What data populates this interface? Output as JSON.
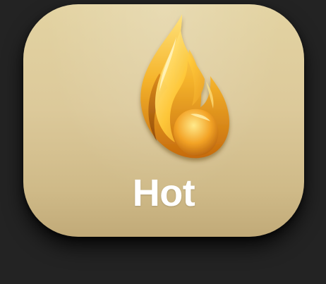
{
  "app_tile": {
    "label": "Hot",
    "icon": "flame-icon",
    "colors": {
      "tile_top": "#e3d3a2",
      "tile_bottom": "#c1aa78",
      "label": "#ffffff",
      "background": "#232323",
      "flame_light": "#ffe070",
      "flame_mid": "#f2a524",
      "flame_dark": "#b8620d"
    }
  }
}
